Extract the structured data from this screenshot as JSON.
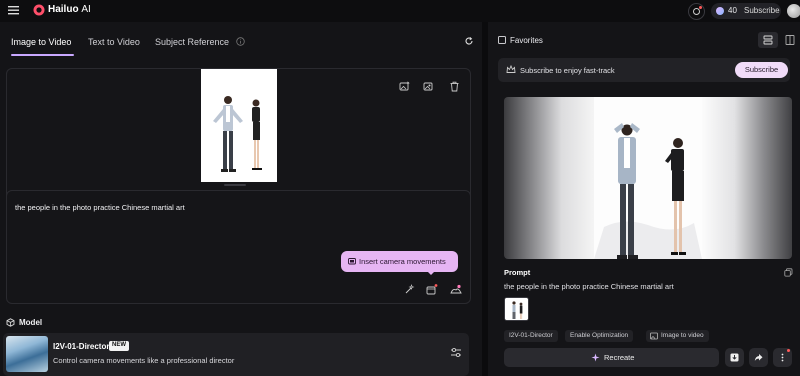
{
  "topbar": {
    "brand_name": "Hailuo",
    "brand_suffix": "AI",
    "credits": "40",
    "subscribe_label": "Subscribe"
  },
  "tabs": [
    {
      "label": "Image to Video",
      "active": true
    },
    {
      "label": "Text to Video",
      "active": false
    },
    {
      "label": "Subject Reference",
      "active": false
    }
  ],
  "prompt": {
    "text": "the people in the photo practice Chinese martial art",
    "tooltip": "Insert camera movements"
  },
  "model": {
    "section_label": "Model",
    "name": "I2V-01-Director",
    "badge": "NEW",
    "description": "Control camera movements like a professional director"
  },
  "right": {
    "favorites_label": "Favorites",
    "banner_text": "Subscribe to enjoy fast-track",
    "banner_button": "Subscribe",
    "prompt_label": "Prompt",
    "prompt_value": "the people in the photo practice Chinese martial art",
    "tags": [
      "I2V-01-Director",
      "Enable Optimization",
      "Image to video"
    ],
    "recreate_label": "Recreate"
  },
  "colors": {
    "accent": "#c9a8ff",
    "tooltip_bg": "#e6b5f3",
    "subscribe_bg": "#f1dcf9",
    "background": "#111114",
    "panel": "#141417"
  },
  "icons": [
    "menu-icon",
    "logo-icon",
    "notification-icon",
    "gem-icon",
    "info-icon",
    "reset-icon",
    "replace-image-icon",
    "edit-image-icon",
    "trash-icon",
    "camera-movement-icon",
    "director-icon",
    "magic-icon",
    "cube-icon",
    "settings-sliders-icon",
    "crown-icon",
    "copy-icon",
    "sparkle-icon",
    "download-icon",
    "share-icon",
    "more-icon"
  ]
}
